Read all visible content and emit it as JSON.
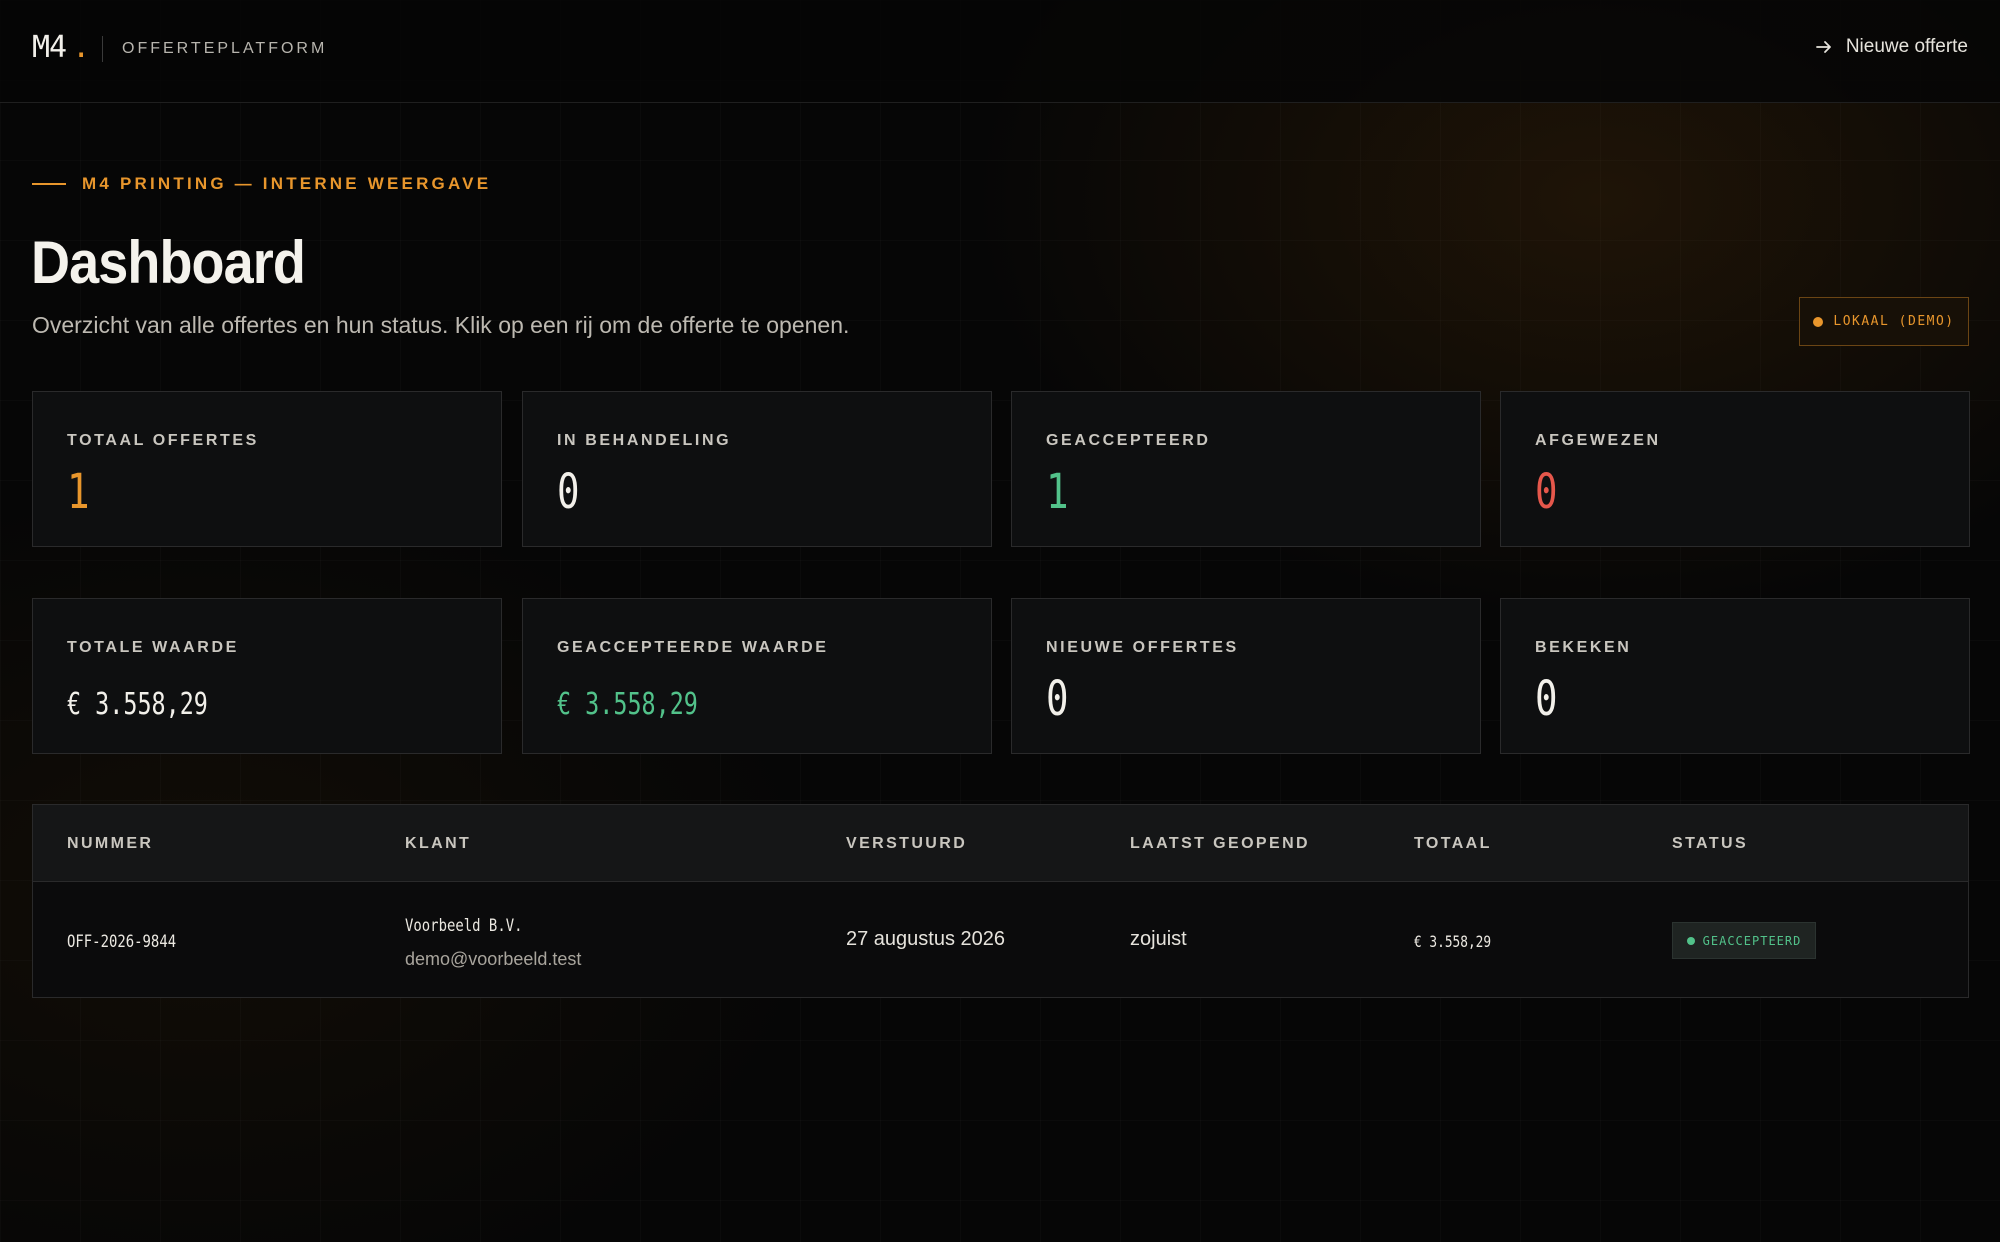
{
  "header": {
    "logo": "M4",
    "logo_dot": ".",
    "platform_name": "OFFERTEPLATFORM",
    "new_quote_label": "Nieuwe offerte"
  },
  "hero": {
    "eyebrow": "M4 PRINTING — INTERNE WEERGAVE",
    "title": "Dashboard",
    "subtitle": "Overzicht van alle offertes en hun status. Klik op een rij om de offerte te openen.",
    "mode_badge": "LOKAAL (DEMO)"
  },
  "stats": [
    {
      "label": "TOTAAL OFFERTES",
      "value": "1"
    },
    {
      "label": "IN BEHANDELING",
      "value": "0"
    },
    {
      "label": "GEACCEPTEERD",
      "value": "1"
    },
    {
      "label": "AFGEWEZEN",
      "value": "0"
    },
    {
      "label": "TOTALE WAARDE",
      "value": "€ 3.558,29"
    },
    {
      "label": "GEACCEPTEERDE WAARDE",
      "value": "€ 3.558,29"
    },
    {
      "label": "NIEUWE OFFERTES",
      "value": "0"
    },
    {
      "label": "BEKEKEN",
      "value": "0"
    }
  ],
  "table": {
    "columns": [
      "NUMMER",
      "KLANT",
      "VERSTUURD",
      "LAATST GEOPEND",
      "TOTAAL",
      "STATUS"
    ],
    "rows": [
      {
        "number": "OFF-2026-9844",
        "client_name": "Voorbeeld B.V.",
        "client_email": "demo@voorbeeld.test",
        "sent": "27 augustus 2026",
        "last_opened": "zojuist",
        "total": "€ 3.558,29",
        "status": "GEACCEPTEERD"
      }
    ]
  },
  "colors": {
    "accent": "#e8962c",
    "positive": "#52c28a",
    "negative": "#e5574b",
    "background": "#060606"
  }
}
